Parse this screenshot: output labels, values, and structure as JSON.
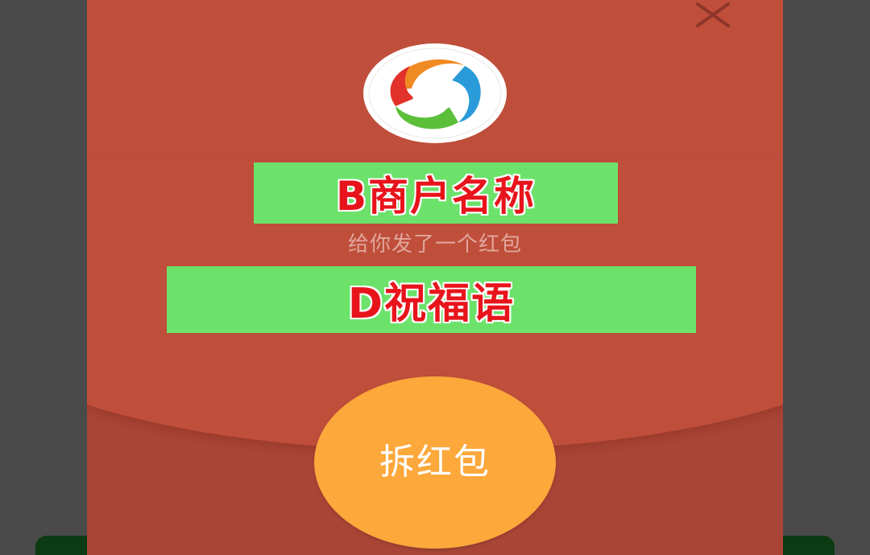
{
  "dialog": {
    "close_icon": "close-icon",
    "logo_icon": "swirl-logo-icon",
    "merchant_name": "B商户名称",
    "subtitle": "给你发了一个红包",
    "blessing": "D祝福语",
    "open_button_label": "拆红包"
  },
  "colors": {
    "envelope": "#bf4e3b",
    "envelope_lower": "#a94536",
    "overlay": "#4a4a4a",
    "highlight_box": "#6ce26b",
    "highlight_text": "#e8141c",
    "open_button": "#fca83b"
  }
}
